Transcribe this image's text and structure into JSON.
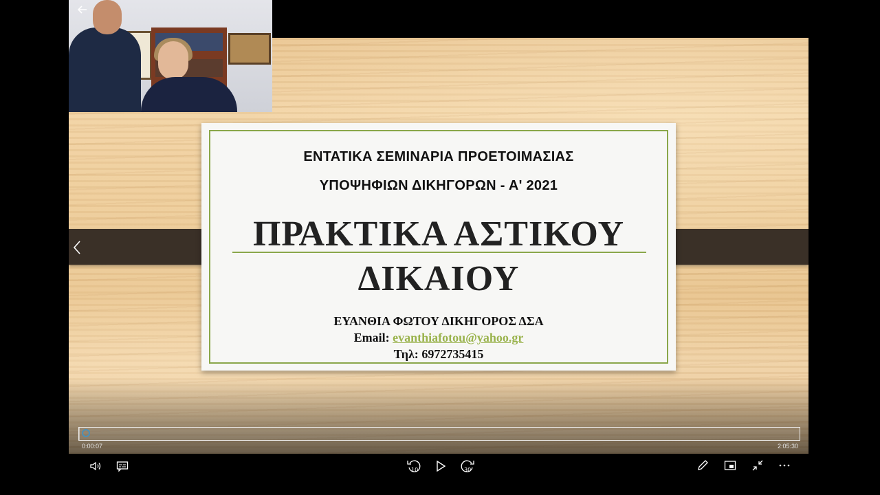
{
  "slide": {
    "heading_line1": "ΕΝΤΑΤΙΚΑ ΣΕΜΙΝΑΡΙΑ ΠΡΟΕΤΟΙΜΑΣΙΑΣ",
    "heading_line2": "ΥΠΟΨΗΦΙΩΝ ΔΙΚΗΓΟΡΩΝ - Α' 2021",
    "title_line1": "ΠΡΑΚΤΙΚΑ ΑΣΤΙΚΟΥ",
    "title_line2": "ΔΙΚΑΙΟΥ",
    "presenter": "ΕΥΑΝΘΙΑ ΦΩΤΟΥ ΔΙΚΗΓΟΡΟΣ ΔΣΑ",
    "email_label": "Email:",
    "email": "evanthiafotou@yahoo.gr",
    "phone_label": "Τηλ:",
    "phone": "6972735415"
  },
  "player": {
    "time_current": "0:00:07",
    "time_total": "2:05:30",
    "progress_fraction": 0.001,
    "skip_back_seconds": "10",
    "skip_forward_seconds": "30",
    "icons": {
      "back": "arrow-left-icon",
      "prev": "chevron-left-icon",
      "volume": "volume-icon",
      "captions": "captions-icon",
      "skip_back": "skip-back-icon",
      "play": "play-icon",
      "skip_forward": "skip-forward-icon",
      "edit": "pencil-icon",
      "mini_view": "mini-view-icon",
      "exit_fullscreen": "exit-fullscreen-icon",
      "more": "more-icon"
    }
  },
  "colors": {
    "accent_green": "#8aa74a",
    "link_green": "#9ab34d",
    "band_brown": "#3a3027"
  }
}
